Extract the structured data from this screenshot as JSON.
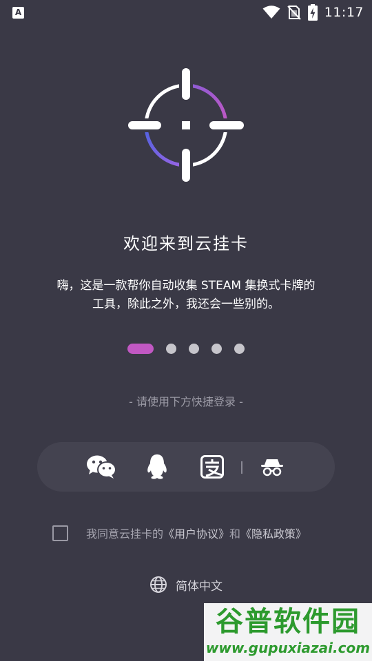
{
  "status_bar": {
    "time": "11:17",
    "app_icon_letter": "A",
    "icons": [
      "app-notification-icon",
      "wifi-icon",
      "no-sim-icon",
      "battery-charging-icon"
    ]
  },
  "logo": {
    "icon": "crosshair-logo-icon",
    "gradient_colors": [
      "#c158c3",
      "#6b5fe0"
    ]
  },
  "welcome": {
    "title": "欢迎来到云挂卡",
    "description_line1": "嗨，这是一款帮你自动收集 STEAM 集换式卡牌的",
    "description_line2": "工具，除此之外，我还会一些别的。"
  },
  "pager": {
    "total": 5,
    "active_index": 0,
    "active_color": "#c158c3"
  },
  "login": {
    "hint": "- 请使用下方快捷登录 -",
    "methods": [
      {
        "name": "wechat",
        "icon": "wechat-icon"
      },
      {
        "name": "qq",
        "icon": "qq-penguin-icon"
      },
      {
        "name": "alipay",
        "icon": "alipay-icon"
      },
      {
        "name": "anonymous",
        "icon": "incognito-icon"
      }
    ]
  },
  "agreement": {
    "prefix": "我同意云挂卡的",
    "user_agreement": "《用户协议》",
    "conjunction": "和",
    "privacy_policy": "《隐私政策》",
    "checked": false
  },
  "language": {
    "icon": "globe-icon",
    "label": "简体中文"
  },
  "watermark": {
    "title": "谷普软件园",
    "url": "www.gupuxiazai.com"
  },
  "colors": {
    "background": "#3a3946",
    "panel": "#444350",
    "accent": "#c158c3"
  }
}
